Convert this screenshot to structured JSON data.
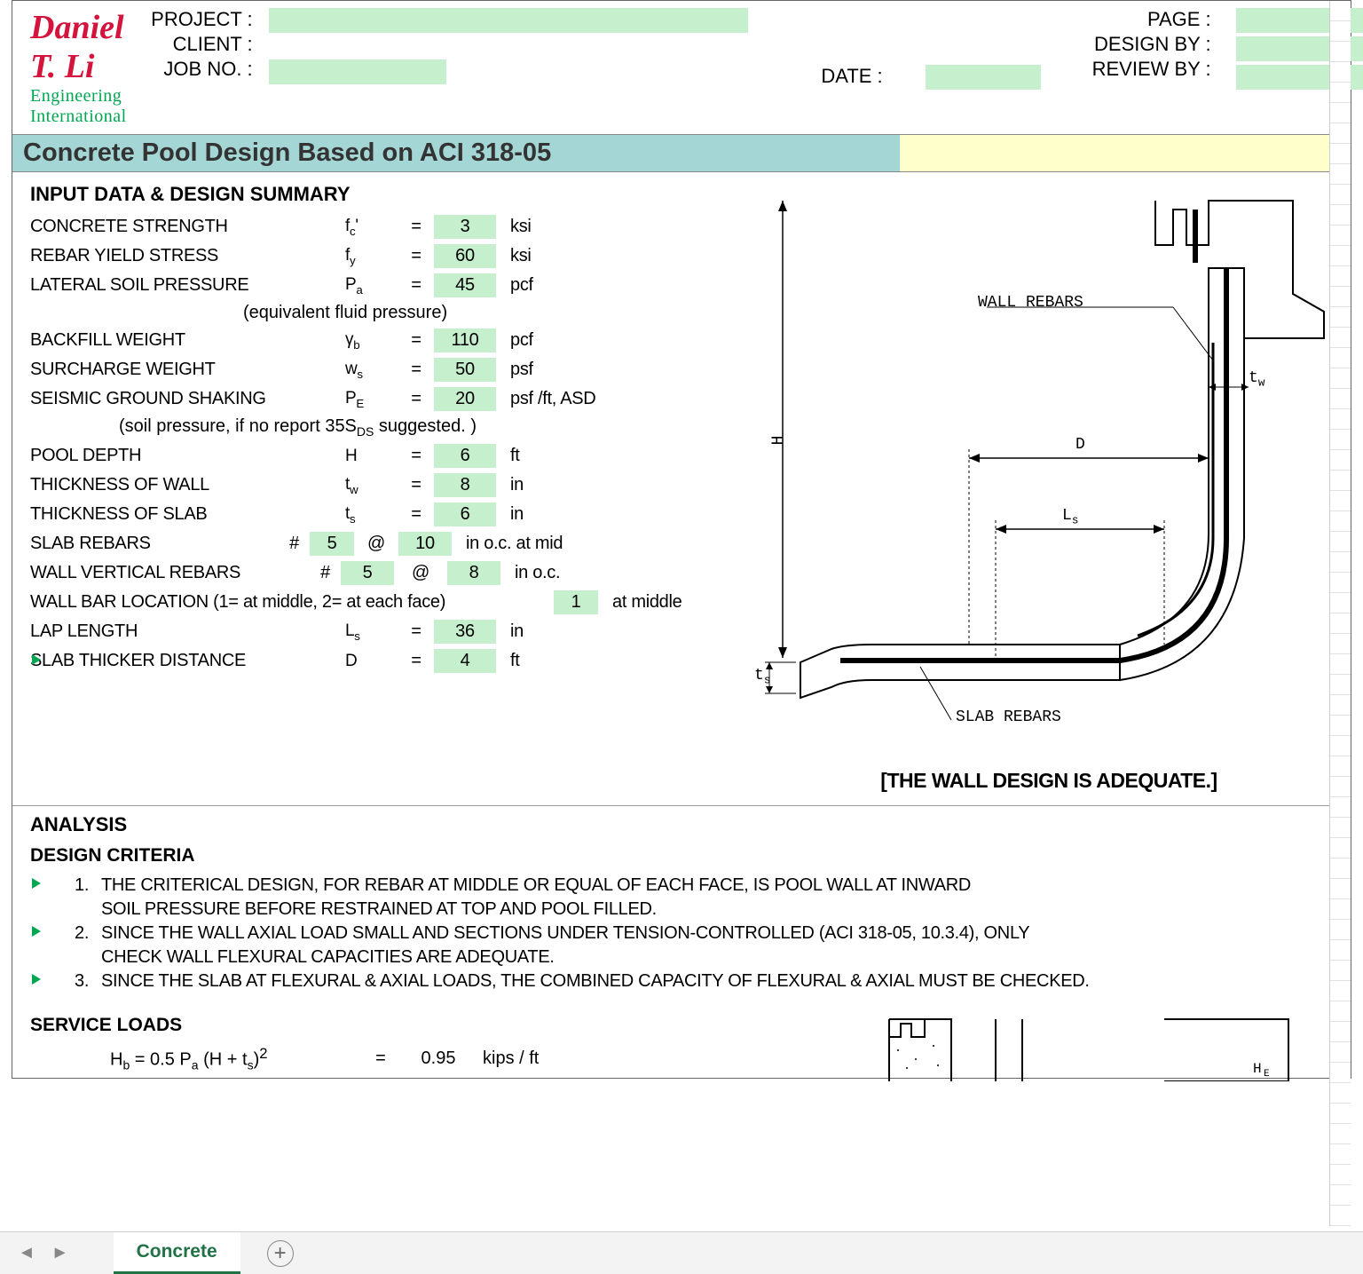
{
  "logo": {
    "name": "Daniel T. Li",
    "sub": "Engineering International"
  },
  "hdr": {
    "project": "PROJECT :",
    "client": "CLIENT :",
    "jobno": "JOB NO. :",
    "date": "DATE :",
    "page": "PAGE :",
    "designby": "DESIGN BY :",
    "reviewby": "REVIEW BY :"
  },
  "title": "Concrete Pool Design Based on ACI 318-05",
  "sec_input": "INPUT DATA & DESIGN SUMMARY",
  "inputs": {
    "conc_str": {
      "label": "CONCRETE STRENGTH",
      "sym": "f",
      "sub": "c",
      "sup": "'",
      "val": "3",
      "unit": "ksi"
    },
    "rebar": {
      "label": "REBAR YIELD STRESS",
      "sym": "f",
      "sub": "y",
      "val": "60",
      "unit": "ksi"
    },
    "lat_soil": {
      "label": "LATERAL SOIL PRESSURE",
      "sym": "P",
      "sub": "a",
      "val": "45",
      "unit": "pcf"
    },
    "efp_note": "(equivalent fluid pressure)",
    "backfill": {
      "label": "BACKFILL WEIGHT",
      "sym": "γ",
      "sub": "b",
      "val": "110",
      "unit": "pcf"
    },
    "surcharge": {
      "label": "SURCHARGE WEIGHT",
      "sym": "w",
      "sub": "s",
      "val": "50",
      "unit": "psf"
    },
    "seismic": {
      "label": "SEISMIC GROUND SHAKING",
      "sym": "P",
      "sub": "E",
      "val": "20",
      "unit": "psf /ft, ASD"
    },
    "seis_note": "(soil pressure, if no report 35S",
    "seis_note_sub": "DS",
    "seis_note2": " suggested. )",
    "depth": {
      "label": "POOL DEPTH",
      "sym": "H",
      "sub": "",
      "val": "6",
      "unit": "ft"
    },
    "t_wall": {
      "label": "THICKNESS OF WALL",
      "sym": "t",
      "sub": "w",
      "val": "8",
      "unit": "in"
    },
    "t_slab": {
      "label": "THICKNESS OF SLAB",
      "sym": "t",
      "sub": "s",
      "val": "6",
      "unit": "in"
    },
    "slab_reb": {
      "label": "SLAB REBARS",
      "hash": "#",
      "size": "5",
      "at": "@",
      "spc": "10",
      "unit": "in o.c. at mid"
    },
    "wall_reb": {
      "label": "WALL VERTICAL REBARS",
      "hash": "#",
      "size": "5",
      "at": "@",
      "spc": "8",
      "unit": "in o.c."
    },
    "wall_loc": {
      "label": "WALL BAR LOCATION (1= at middle, 2= at each face)",
      "val": "1",
      "res": "at middle"
    },
    "lap": {
      "label": "LAP LENGTH",
      "sym": "L",
      "sub": "s",
      "val": "36",
      "unit": "in"
    },
    "slab_dist": {
      "label": "SLAB THICKER DISTANCE",
      "sym": "D",
      "sub": "",
      "val": "4",
      "unit": "ft"
    }
  },
  "diag_labels": {
    "wall_rebars": "WALL REBARS",
    "slab_rebars": "SLAB REBARS",
    "H": "H",
    "tw": "t",
    "tw_sub": "w",
    "ts": "t",
    "ts_sub": "s",
    "D": "D",
    "Ls": "L",
    "Ls_sub": "s"
  },
  "adequate": "[THE WALL DESIGN IS ADEQUATE.]",
  "sec_analysis": "ANALYSIS",
  "sec_criteria": "DESIGN CRITERIA",
  "criteria": [
    {
      "n": "1.",
      "t1": "THE CRITERICAL DESIGN, FOR REBAR AT MIDDLE OR EQUAL OF EACH FACE, IS POOL WALL AT INWARD",
      "t2": "SOIL PRESSURE BEFORE RESTRAINED AT TOP AND POOL FILLED."
    },
    {
      "n": "2.",
      "t1": "SINCE THE WALL AXIAL LOAD SMALL AND SECTIONS UNDER TENSION-CONTROLLED (ACI 318-05, 10.3.4), ONLY",
      "t2": "CHECK WALL FLEXURAL CAPACITIES ARE ADEQUATE."
    },
    {
      "n": "3.",
      "t1": "SINCE THE SLAB AT FLEXURAL & AXIAL LOADS, THE COMBINED CAPACITY OF FLEXURAL & AXIAL MUST BE CHECKED.",
      "t2": ""
    }
  ],
  "sec_service": "SERVICE LOADS",
  "service": {
    "hb": {
      "f": "H",
      "fsub": "b",
      "f2": " = 0.5 P",
      "f2sub": "a",
      "f3": " (H + t",
      "f3sub": "s",
      "f4": ")",
      "f4sup": "2",
      "val": "0.95",
      "unit": "kips / ft"
    }
  },
  "serv_diag": {
    "he": "H",
    "he_sub": "E"
  },
  "tab": "Concrete"
}
